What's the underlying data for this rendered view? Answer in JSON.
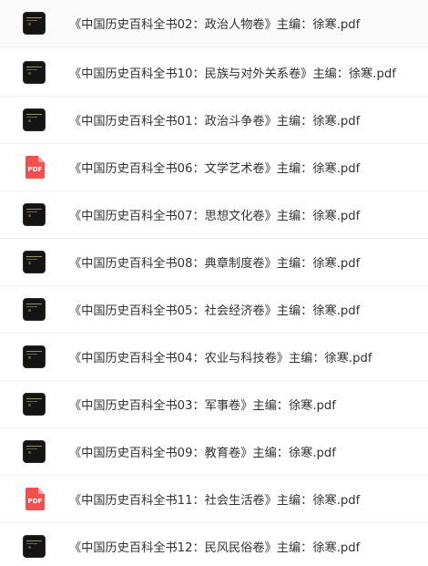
{
  "files": [
    {
      "name": "《中国历史百科全书02：政治人物卷》主编：徐寒.pdf",
      "icon": "book-thumbnail-icon"
    },
    {
      "name": "《中国历史百科全书10：民族与对外关系卷》主编：徐寒.pdf",
      "icon": "book-thumbnail-icon"
    },
    {
      "name": "《中国历史百科全书01：政治斗争卷》主编：徐寒.pdf",
      "icon": "book-thumbnail-icon"
    },
    {
      "name": "《中国历史百科全书06：文学艺术卷》主编：徐寒.pdf",
      "icon": "pdf-file-icon"
    },
    {
      "name": "《中国历史百科全书07：思想文化卷》主编：徐寒.pdf",
      "icon": "book-thumbnail-icon"
    },
    {
      "name": "《中国历史百科全书08：典章制度卷》主编：徐寒.pdf",
      "icon": "book-thumbnail-icon"
    },
    {
      "name": "《中国历史百科全书05：社会经济卷》主编：徐寒.pdf",
      "icon": "book-thumbnail-icon"
    },
    {
      "name": "《中国历史百科全书04：农业与科技卷》主编：徐寒.pdf",
      "icon": "book-thumbnail-icon"
    },
    {
      "name": "《中国历史百科全书03：军事卷》主编：徐寒.pdf",
      "icon": "book-thumbnail-icon"
    },
    {
      "name": "《中国历史百科全书09：教育卷》主编：徐寒.pdf",
      "icon": "book-thumbnail-icon"
    },
    {
      "name": "《中国历史百科全书11：社会生活卷》主编：徐寒.pdf",
      "icon": "pdf-file-icon"
    },
    {
      "name": "《中国历史百科全书12：民风民俗卷》主编：徐寒.pdf",
      "icon": "book-thumbnail-icon"
    }
  ],
  "pdf_badge_label": "PDF",
  "colors": {
    "pdf_badge": "#f0514f",
    "text": "#333333",
    "divider": "#f0f0f0"
  }
}
